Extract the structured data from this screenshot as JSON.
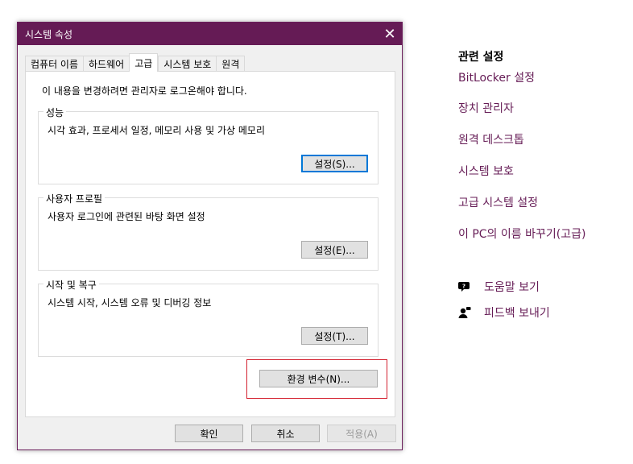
{
  "dialog": {
    "title": "시스템 속성",
    "close_glyph": "✕",
    "tabs": [
      "컴퓨터 이름",
      "하드웨어",
      "고급",
      "시스템 보호",
      "원격"
    ],
    "active_tab": "고급",
    "notice": "이 내용을 변경하려면 관리자로 로그온해야 합니다.",
    "groups": [
      {
        "legend": "성능",
        "desc": "시각 효과, 프로세서 일정, 메모리 사용 및 가상 메모리",
        "button": "설정(S)..."
      },
      {
        "legend": "사용자 프로필",
        "desc": "사용자 로그인에 관련된 바탕 화면 설정",
        "button": "설정(E)..."
      },
      {
        "legend": "시작 및 복구",
        "desc": "시스템 시작, 시스템 오류 및 디버깅 정보",
        "button": "설정(T)..."
      }
    ],
    "env_button": "환경 변수(N)...",
    "footer": {
      "ok": "확인",
      "cancel": "취소",
      "apply": "적용(A)"
    },
    "colors": {
      "titlebar": "#651b55",
      "highlight": "#d3202e",
      "focus": "#0078d7"
    }
  },
  "related": {
    "header": "관련 설정",
    "links": [
      "BitLocker 설정",
      "장치 관리자",
      "원격 데스크톱",
      "시스템 보호",
      "고급 시스템 설정",
      "이 PC의 이름 바꾸기(고급)"
    ],
    "link_color": "#651b55"
  },
  "support": {
    "items": [
      {
        "icon": "help-chat-icon",
        "label": "도움말 보기"
      },
      {
        "icon": "feedback-person-icon",
        "label": "피드백 보내기"
      }
    ]
  }
}
